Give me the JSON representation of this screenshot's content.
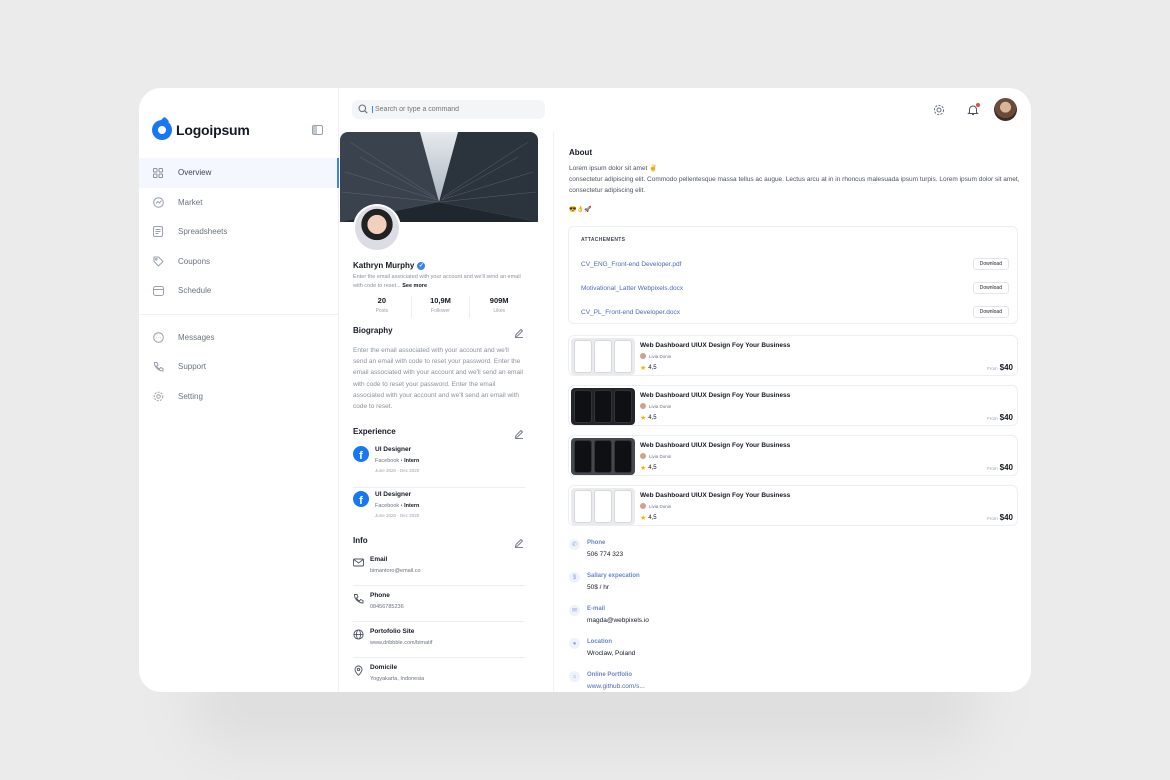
{
  "brand": {
    "name": "Logoipsum",
    "accent": "#3b82f6",
    "fb_blue": "#1877f2"
  },
  "sidebar": {
    "items": [
      {
        "label": "Overview",
        "icon": "grid-icon",
        "active": true
      },
      {
        "label": "Market",
        "icon": "chart-icon",
        "active": false
      },
      {
        "label": "Spreadsheets",
        "icon": "document-icon",
        "active": false
      },
      {
        "label": "Coupons",
        "icon": "tag-icon",
        "active": false
      },
      {
        "label": "Schedule",
        "icon": "calendar-icon",
        "active": false
      }
    ],
    "secondary": [
      {
        "label": "Messages",
        "icon": "chat-icon"
      },
      {
        "label": "Support",
        "icon": "phone-icon"
      },
      {
        "label": "Setting",
        "icon": "gear-icon"
      }
    ]
  },
  "search": {
    "placeholder": "Search or type a command"
  },
  "profile": {
    "name": "Kathryn Murphy",
    "description": "Enter the email associated with your account and we'll send an email with code to reset...",
    "see_more": "See more",
    "stats": [
      {
        "value": "20",
        "label": "Posts"
      },
      {
        "value": "10,9M",
        "label": "Follower"
      },
      {
        "value": "909M",
        "label": "Likes"
      }
    ],
    "biography_title": "Biography",
    "biography": "Enter the email associated with your account and we'll send an email with code to reset your password. Enter the email associated with your account and we'll send an email with code to reset your password. Enter the email associated with your account and we'll send an email with code to reset.",
    "experience_title": "Experience",
    "experience": [
      {
        "title": "UI Designer",
        "company": "Facebook",
        "type": "Intern",
        "dates": "June 2020 - Dec 2020"
      },
      {
        "title": "UI Designer",
        "company": "Facebook",
        "type": "Intern",
        "dates": "June 2020 - Dec 2020"
      }
    ],
    "info_title": "Info",
    "info": [
      {
        "label": "Email",
        "value": "bimantoro@email.co",
        "icon": "mail-icon"
      },
      {
        "label": "Phone",
        "value": "08456785236",
        "icon": "phone-icon"
      },
      {
        "label": "Portofolio Site",
        "value": "www.dribbble.com/bimatif",
        "icon": "globe-icon"
      },
      {
        "label": "Domicile",
        "value": "Yogyakarta, Indonesia",
        "icon": "location-icon"
      }
    ]
  },
  "about": {
    "title": "About",
    "line1": "Lorem ipsum dolor sit amet ✌",
    "line2": "consectetur adipiscing elit. Commodo pellentesque massa tellus ac augue. Lectus arcu at in in rhoncus malesuada ipsum turpis. Lorem ipsum dolor sit amet, consectetur adipiscing elit.",
    "emojis": "😎👌🚀"
  },
  "attachments": {
    "header": "ATTACHEMENTS",
    "download_label": "Download",
    "files": [
      "CV_ENG_Front-end Developer.pdf",
      "Motivational_Latter Webpixels.docx",
      "CV_PL_Front-end Developer.docx"
    ]
  },
  "products": [
    {
      "title": "Web Dashboard UIUX Design Foy Your Business",
      "author": "Livia Donin",
      "rating": "4,5",
      "from": "From",
      "price": "$40",
      "theme": "light"
    },
    {
      "title": "Web Dashboard UIUX Design Foy Your Business",
      "author": "Livia Donin",
      "rating": "4,5",
      "from": "From",
      "price": "$40",
      "theme": "dark"
    },
    {
      "title": "Web Dashboard UIUX Design Foy Your Business",
      "author": "Livia Donin",
      "rating": "4,5",
      "from": "From",
      "price": "$40",
      "theme": "mid"
    },
    {
      "title": "Web Dashboard UIUX Design Foy Your Business",
      "author": "Livia Donin",
      "rating": "4,5",
      "from": "From",
      "price": "$40",
      "theme": "light"
    }
  ],
  "details": [
    {
      "label": "Phone",
      "value": "506 774 323",
      "icon": "phone-icon"
    },
    {
      "label": "Sallary expecation",
      "value": "50$ / hr",
      "icon": "money-icon"
    },
    {
      "label": "E-mail",
      "value": "magda@webpixels.io",
      "icon": "mail-icon"
    },
    {
      "label": "Location",
      "value": "Wroclaw, Poland",
      "icon": "location-icon"
    },
    {
      "label": "Online Portfolio",
      "value": "www.github.com/s...",
      "icon": "link-icon",
      "link": true
    }
  ]
}
